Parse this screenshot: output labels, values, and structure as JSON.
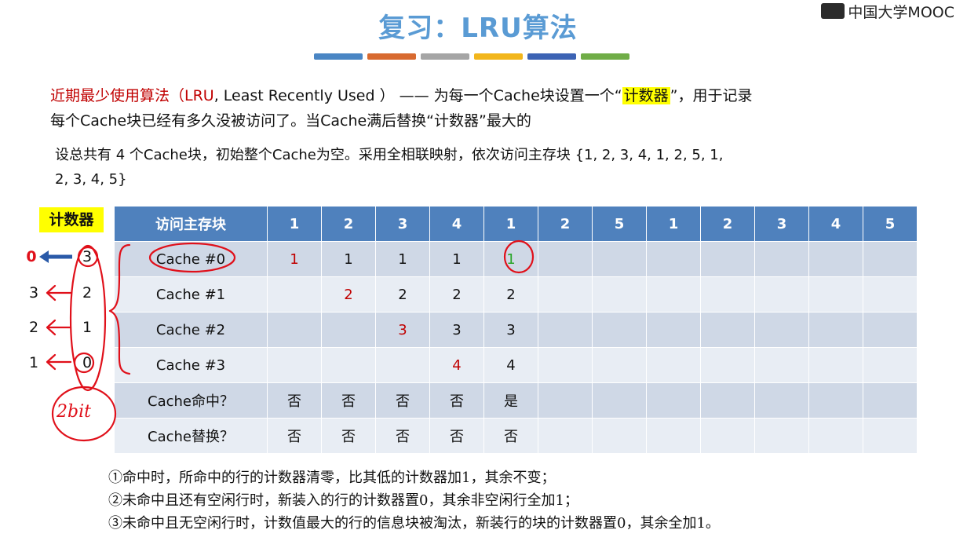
{
  "title": "复习：LRU算法",
  "logo_text": "中国大学MOOC",
  "accent_bars": [
    "#4a86c4",
    "#d86a30",
    "#a5a5a5",
    "#f2b61c",
    "#3c63b4",
    "#70ad47"
  ],
  "intro": {
    "red_part": "近期最少使用算法（",
    "lru_label": "LRU",
    "paren_rest": ", Least Recently Used ）",
    "dash_text": "—— 为每一个Cache块设置一个“",
    "highlight": "计数器",
    "after_highlight": "”，用于记录",
    "line2": "每个Cache块已经有多久没被访问了。当Cache满后替换“计数器”最大的"
  },
  "problem": {
    "line1": "设总共有 4 个Cache块，初始整个Cache为空。采用全相联映射，依次访问主存块 {1, 2, 3, 4, 1, 2, 5, 1,",
    "line2": "2, 3, 4, 5}"
  },
  "counter_label": "计数器",
  "table": {
    "header_label": "访问主存块",
    "sequence": [
      "1",
      "2",
      "3",
      "4",
      "1",
      "2",
      "5",
      "1",
      "2",
      "3",
      "4",
      "5"
    ],
    "rows": [
      {
        "label": "Cache #0",
        "cells": [
          "1",
          "1",
          "1",
          "1",
          "1",
          "",
          "",
          "",
          "",
          "",
          "",
          ""
        ]
      },
      {
        "label": "Cache #1",
        "cells": [
          "",
          "2",
          "2",
          "2",
          "2",
          "",
          "",
          "",
          "",
          "",
          "",
          ""
        ]
      },
      {
        "label": "Cache #2",
        "cells": [
          "",
          "",
          "3",
          "3",
          "3",
          "",
          "",
          "",
          "",
          "",
          "",
          ""
        ]
      },
      {
        "label": "Cache #3",
        "cells": [
          "",
          "",
          "",
          "4",
          "4",
          "",
          "",
          "",
          "",
          "",
          "",
          ""
        ]
      },
      {
        "label": "Cache命中？",
        "cells": [
          "否",
          "否",
          "否",
          "否",
          "是",
          "",
          "",
          "",
          "",
          "",
          "",
          ""
        ]
      },
      {
        "label": "Cache替换？",
        "cells": [
          "否",
          "否",
          "否",
          "否",
          "否",
          "",
          "",
          "",
          "",
          "",
          "",
          ""
        ]
      }
    ]
  },
  "left_counters": {
    "new": [
      "0",
      "3",
      "2",
      "1"
    ],
    "old": [
      "3",
      "2",
      "1",
      "0"
    ],
    "handwritten_note": "2bit"
  },
  "notes": [
    "①命中时，所命中的行的计数器清零，比其低的计数器加1，其余不变；",
    "②未命中且还有空闲行时，新装入的行的计数器置0，其余非空闲行全加1；",
    "③未命中且无空闲行时，计数值最大的行的信息块被淘汰，新装行的块的计数器置0，其余全加1。"
  ]
}
